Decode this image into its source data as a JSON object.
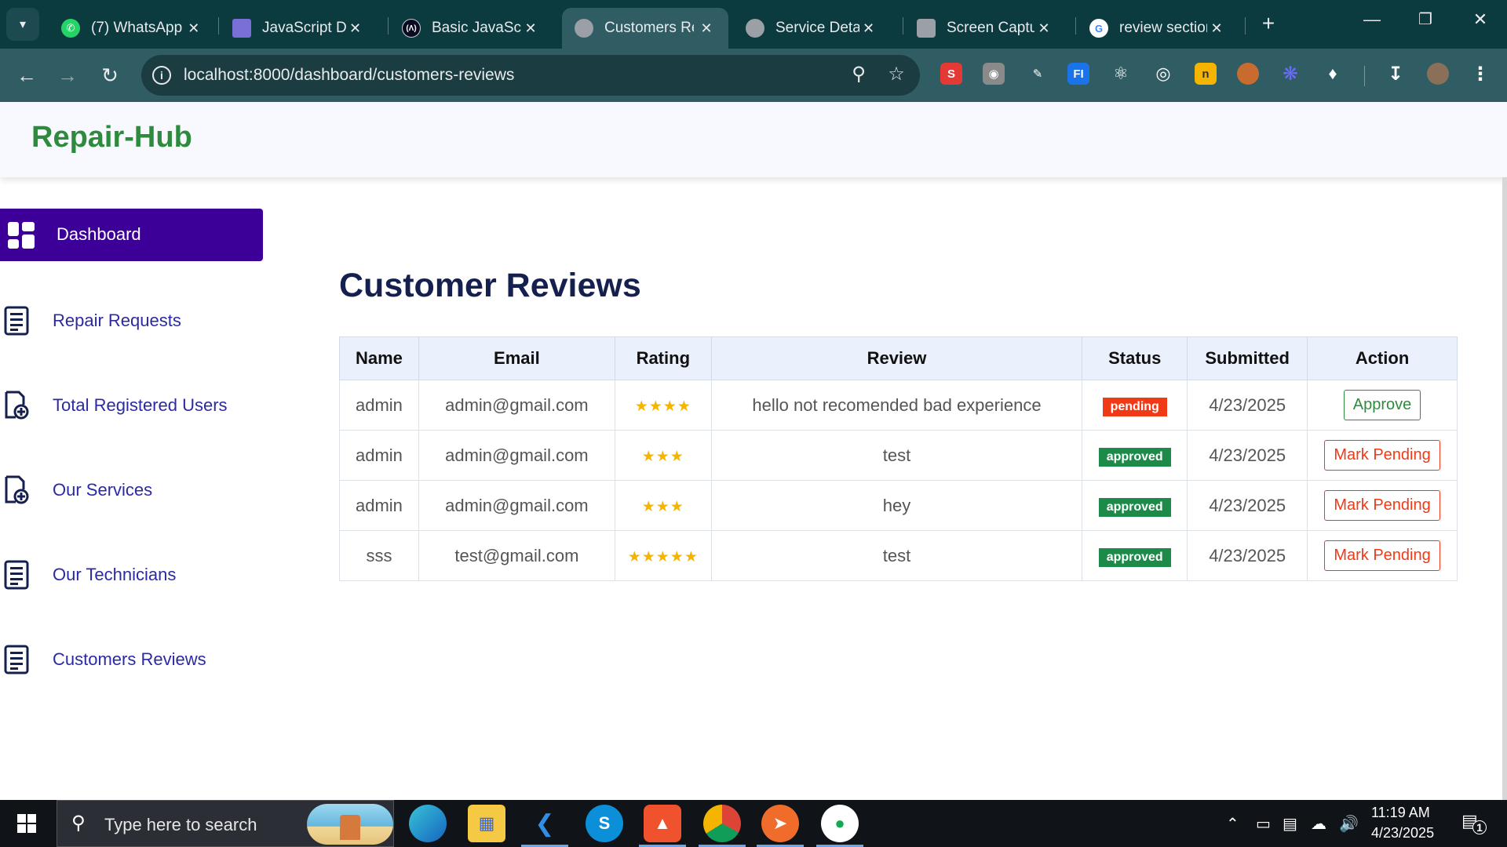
{
  "browser": {
    "tabs": [
      {
        "title": "(7) WhatsApp",
        "icon": "whatsapp-icon",
        "color": "#25d366"
      },
      {
        "title": "JavaScript Dev",
        "icon": "landscape-icon",
        "color": "#7a6fd6"
      },
      {
        "title": "Basic JavaScript",
        "icon": "freecodecamp-icon",
        "color": "#0a0a23"
      },
      {
        "title": "Customers Reviews",
        "icon": "globe-icon",
        "color": "#9aa0a6",
        "active": true
      },
      {
        "title": "Service Details",
        "icon": "globe-icon",
        "color": "#9aa0a6"
      },
      {
        "title": "Screen Capture",
        "icon": "camera-icon",
        "color": "#9aa0a6"
      },
      {
        "title": "review section",
        "icon": "google-icon",
        "color": "#ffffff"
      }
    ],
    "url": "localhost:8000/dashboard/customers-reviews"
  },
  "app": {
    "brand": "Repair-Hub",
    "sidebar": [
      {
        "label": "Dashboard",
        "active": true
      },
      {
        "label": "Repair Requests"
      },
      {
        "label": "Total Registered Users"
      },
      {
        "label": "Our Services"
      },
      {
        "label": "Our Technicians"
      },
      {
        "label": "Customers Reviews"
      }
    ],
    "page_title": "Customer Reviews",
    "columns": [
      "Name",
      "Email",
      "Rating",
      "Review",
      "Status",
      "Submitted",
      "Action"
    ],
    "rows": [
      {
        "name": "admin",
        "email": "admin@gmail.com",
        "rating": 4,
        "stars": "★★★★",
        "review": "hello not recomended bad experience",
        "status": "pending",
        "submitted": "4/23/2025",
        "action": "Approve"
      },
      {
        "name": "admin",
        "email": "admin@gmail.com",
        "rating": 3,
        "stars": "★★★",
        "review": "test",
        "status": "approved",
        "submitted": "4/23/2025",
        "action": "Mark Pending"
      },
      {
        "name": "admin",
        "email": "admin@gmail.com",
        "rating": 3,
        "stars": "★★★",
        "review": "hey",
        "status": "approved",
        "submitted": "4/23/2025",
        "action": "Mark Pending"
      },
      {
        "name": "sss",
        "email": "test@gmail.com",
        "rating": 5,
        "stars": "★★★★★",
        "review": "test",
        "status": "approved",
        "submitted": "4/23/2025",
        "action": "Mark Pending"
      }
    ],
    "colors": {
      "brand": "#2e8b3e",
      "active_nav": "#3c0098",
      "nav_text": "#2b2aa3",
      "pending": "#f03a17",
      "approved": "#1e8a4a",
      "star": "#f5b400"
    }
  },
  "taskbar": {
    "search_placeholder": "Type here to search",
    "time": "11:19 AM",
    "date": "4/23/2025",
    "notification_count": "1"
  }
}
